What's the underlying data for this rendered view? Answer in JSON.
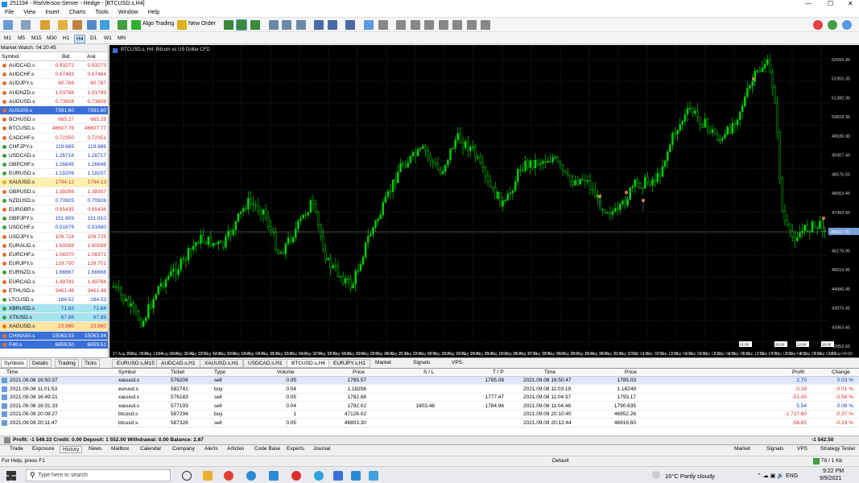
{
  "window": {
    "title": "251194 - RistVersos-Server - Hedge - [BTCUSD.s,H4]"
  },
  "menu": [
    "File",
    "View",
    "Insert",
    "Charts",
    "Tools",
    "Window",
    "Help"
  ],
  "toolbar": {
    "algo_trading": "Algo Trading",
    "new_order": "New Order"
  },
  "timeframes": [
    "M1",
    "M5",
    "M15",
    "M30",
    "H1",
    "H4",
    "D1",
    "W1",
    "MN"
  ],
  "market_watch": {
    "title": "Market Watch: 04:20:45",
    "col_symbol": "Symbol",
    "col_bid": "Bid",
    "col_ask": "Ask",
    "rows": [
      {
        "s": "AUDCAD.s",
        "b": "0.93272",
        "a": "0.93273",
        "c": "#e07030"
      },
      {
        "s": "AUDCHF.s",
        "b": "0.67483",
        "a": "0.67484",
        "c": "#e07030"
      },
      {
        "s": "AUDJPY.s",
        "b": "80.768",
        "a": "80.787",
        "c": "#e07030"
      },
      {
        "s": "AUDNZD.s",
        "b": "1.03788",
        "a": "1.03789",
        "c": "#e07030"
      },
      {
        "s": "AUDUSD.s",
        "b": "0.73608",
        "a": "0.73609",
        "c": "#e07030"
      },
      {
        "s": "AUS200.s",
        "b": "7391.60",
        "a": "7391.60",
        "c": "#e07030",
        "hl": "#3a6fd8"
      },
      {
        "s": "BCHUSD.s",
        "b": "665.27",
        "a": "665.28",
        "c": "#e07030"
      },
      {
        "s": "BTCUSD.s",
        "b": "46607.76",
        "a": "46607.77",
        "c": "#e07030"
      },
      {
        "s": "CADCHF.s",
        "b": "0.72350",
        "a": "0.72351",
        "c": "#e07030"
      },
      {
        "s": "CHFJPY.s",
        "b": "119.665",
        "a": "119.686",
        "c": "#3aa040"
      },
      {
        "s": "USDCAD.s",
        "b": "1.26716",
        "a": "1.26717",
        "c": "#3aa040"
      },
      {
        "s": "GBPCHF.s",
        "b": "1.26845",
        "a": "1.26846",
        "c": "#3aa040"
      },
      {
        "s": "EURUSD.s",
        "b": "1.18206",
        "a": "1.18207",
        "c": "#3aa040"
      },
      {
        "s": "XAUUSD.s",
        "b": "1794.12",
        "a": "1794.13",
        "c": "#e0b020",
        "hl": "#fff2b0"
      },
      {
        "s": "GBPUSD.s",
        "b": "1.38356",
        "a": "1.38357",
        "c": "#e07030"
      },
      {
        "s": "NZDUSD.s",
        "b": "0.70925",
        "a": "0.70926",
        "c": "#3aa040"
      },
      {
        "s": "EURGBP.s",
        "b": "0.85435",
        "a": "0.85436",
        "c": "#e07030"
      },
      {
        "s": "GBPJPY.s",
        "b": "151.809",
        "a": "151.810",
        "c": "#3aa040"
      },
      {
        "s": "USDCHF.s",
        "b": "0.91679",
        "a": "0.91680",
        "c": "#3aa040"
      },
      {
        "s": "USDJPY.s",
        "b": "109.724",
        "a": "109.725",
        "c": "#e07030"
      },
      {
        "s": "EURAUD.s",
        "b": "1.60588",
        "a": "1.60589",
        "c": "#e07030"
      },
      {
        "s": "EURCHF.s",
        "b": "1.08370",
        "a": "1.08371",
        "c": "#e07030"
      },
      {
        "s": "EURJPY.s",
        "b": "129.700",
        "a": "129.701",
        "c": "#e07030"
      },
      {
        "s": "EURNZD.s",
        "b": "1.66667",
        "a": "1.66668",
        "c": "#3aa040"
      },
      {
        "s": "EURCAD.s",
        "b": "1.49783",
        "a": "1.49784",
        "c": "#e07030"
      },
      {
        "s": "ETHUSD.s",
        "b": "3461.48",
        "a": "3461.49",
        "c": "#e07030"
      },
      {
        "s": "LTCUSD.s",
        "b": "184.52",
        "a": "184.53",
        "c": "#3aa040"
      },
      {
        "s": "XBRUSD.s",
        "b": "71.63",
        "a": "71.64",
        "c": "#3aa040",
        "hl": "#a8e4f0"
      },
      {
        "s": "XTIUSD.s",
        "b": "67.88",
        "a": "67.89",
        "c": "#3aa040",
        "hl": "#a8e4f0"
      },
      {
        "s": "XAGUSD.s",
        "b": "23.980",
        "a": "23.980",
        "c": "#e07030",
        "hl": "#ffe4a0"
      },
      {
        "s": "CHINA50.s",
        "b": "15063.03",
        "a": "15063.04",
        "c": "#e07030",
        "hl": "#3a6fd8"
      },
      {
        "s": "F40.s",
        "b": "6659.50",
        "a": "6659.51",
        "c": "#e07030",
        "hl": "#3a6fd8"
      }
    ],
    "tabs": [
      "Symbols",
      "Details",
      "Trading",
      "Ticks"
    ]
  },
  "chart": {
    "label": "BTCUSD.s, H4: Bitcoin vs US Dollar CFD",
    "price_line": "46607.76",
    "y_ticks": [
      "52656.40",
      "51955.35",
      "51380.35",
      "50818.35",
      "49936.90",
      "49307.40",
      "48576.55",
      "48063.45",
      "47493.90",
      "46892.40",
      "46176.95",
      "45615.45",
      "44990.45",
      "43975.45",
      "43363.40",
      "42952.65"
    ],
    "x_ticks": [
      "27 Aug 2021",
      "8 Aug 20:00",
      "9 Aug 12:00",
      "10 Aug 04:00",
      "10 Aug 20:00",
      "11 Aug 12:00",
      "12 Aug 04:00",
      "12 Aug 20:00",
      "13 Aug 12:00",
      "14 Aug 04:00",
      "14 Aug 20:00",
      "15 Aug 12:00",
      "16 Aug 04:00",
      "16 Aug 20:00",
      "17 Aug 12:00",
      "18 Aug 04:00",
      "18 Aug 20:00",
      "19 Aug 12:00",
      "20 Aug 04:00",
      "20 Aug 20:00",
      "21 Aug 12:00",
      "22 Aug 04:00",
      "22 Aug 20:00",
      "23 Aug 12:00",
      "24 Aug 04:00",
      "24 Aug 20:00",
      "25 Aug 12:00",
      "26 Aug 04:00",
      "26 Aug 20:00",
      "27 Aug 12:00",
      "28 Aug 04:00",
      "28 Aug 20:00",
      "29 Aug 12:00",
      "30 Aug 04:00",
      "30 Aug 20:00",
      "31 Aug 12:00",
      "1 Sep 04:00",
      "1 Sep 20:00",
      "2 Sep 12:00",
      "3 Sep 04:00",
      "3 Sep 20:00",
      "4 Sep 12:00",
      "5 Sep 04:00",
      "5 Sep 20:00",
      "6 Sep 12:00",
      "7 Sep 04:00",
      "7 Sep 12:00",
      "8 Sep 04:00",
      "8 Sep 20:00",
      "9 Sep 12:00",
      "10 Sep 04:00"
    ],
    "flag_labels": [
      "01:00",
      "20:00",
      "12:00",
      "16:00"
    ],
    "tabs": [
      "EURUSD.s,M15",
      "AUDCAD.s,H1",
      "XAUUSD.s,H1",
      "USDCAD.s,H1",
      "BTCUSD.s,H4",
      "EURJPY.s,H1"
    ],
    "extra_tabs": [
      "Market",
      "Signals",
      "VPS"
    ]
  },
  "terminal": {
    "headers": [
      "Time",
      "Symbol",
      "Ticket",
      "Type",
      "Volume",
      "Price",
      "S / L",
      "T / P",
      "Time",
      "Price",
      "Profit",
      "Change"
    ],
    "rows": [
      [
        "2021.09.08 16:50:37",
        "xauusd.s",
        "576206",
        "sell",
        "0.05",
        "1785.57",
        "",
        "1785.08",
        "2021.09.08 16:50:47",
        "1785.03",
        "2.70",
        "0.03 %"
      ],
      [
        "2021.09.08 11:01:53",
        "eurusd.s",
        "582741",
        "buy",
        "0.04",
        "1.18256",
        "",
        "",
        "2021.09.08 11:03:19",
        "1.18249",
        "-0.28",
        "-0.01 %"
      ],
      [
        "2021.09.08 16:49:21",
        "xauusd.s",
        "576183",
        "sell",
        "0.05",
        "1782.88",
        "",
        "1777.47",
        "2021.09.08 11:04:37",
        "1793.17",
        "-51.45",
        "-0.58 %"
      ],
      [
        "2021.09.08 18:31:33",
        "xauusd.s",
        "577193",
        "sell",
        "0.04",
        "1792.02",
        "1803.46",
        "1784.96",
        "2021.09.08 11:04:48",
        "1790.635",
        "5.54",
        "0.08 %"
      ],
      [
        "2021.09.09 20:08:27",
        "btcusd.s",
        "587294",
        "buy",
        "1",
        "47126.02",
        "",
        "",
        "2021.09.09 20:10:40",
        "46952.26",
        "-1 737.60",
        "-0.37 %"
      ],
      [
        "2021.09.09 20:11:47",
        "btcusd.s",
        "587326",
        "sell",
        "0.05",
        "46803.30",
        "",
        "",
        "2021.09.09 20:12:44",
        "46916.60",
        "-56.65",
        "-0.24 %"
      ]
    ],
    "totals": "Profit: -1 549.33  Credit: 0.00  Deposit: 1 552.00  Withdrawal: 0.00  Balance: 2.67",
    "total_value": "-1 542.50",
    "tabs": [
      "Trade",
      "Exposure",
      "History",
      "News",
      "Mailbox",
      "Calendar",
      "Company",
      "Alerts",
      "Articles",
      "Code Base",
      "Experts",
      "Journal"
    ],
    "right_tabs": [
      "Market",
      "Signals",
      "VPS",
      "Strategy Tester"
    ]
  },
  "status": {
    "help": "For Help, press F1",
    "profile": "Default",
    "traffic": "79 / 1 Kb"
  },
  "taskbar": {
    "search": "Type here to search",
    "weather": "16°C  Partly cloudy",
    "time": "9:22 PM",
    "date": "9/9/2021"
  }
}
